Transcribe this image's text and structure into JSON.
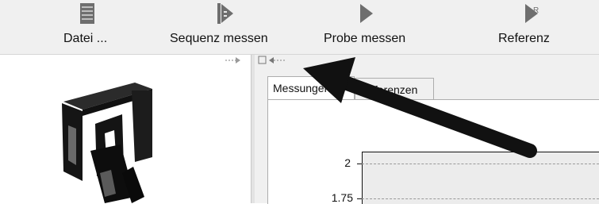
{
  "toolbar": {
    "buttons": [
      {
        "label": "Datei ...",
        "icon": "document-icon"
      },
      {
        "label": "Sequenz messen",
        "icon": "sequence-play-icon"
      },
      {
        "label": "Probe messen",
        "icon": "play-icon"
      },
      {
        "label": "Referenz",
        "icon": "reference-play-icon"
      }
    ]
  },
  "tabs": [
    {
      "label": "Messungen",
      "active": true
    },
    {
      "label": "Referenzen",
      "active": false
    }
  ],
  "chart_data": {
    "type": "line",
    "y_ticks": [
      "2",
      "1.75"
    ],
    "grid": true
  },
  "colors": {
    "toolbar_bg": "#f0f0f0",
    "panel_bg": "#f0f0f0",
    "plot_bg": "#ececec",
    "arrow": "#111111"
  }
}
